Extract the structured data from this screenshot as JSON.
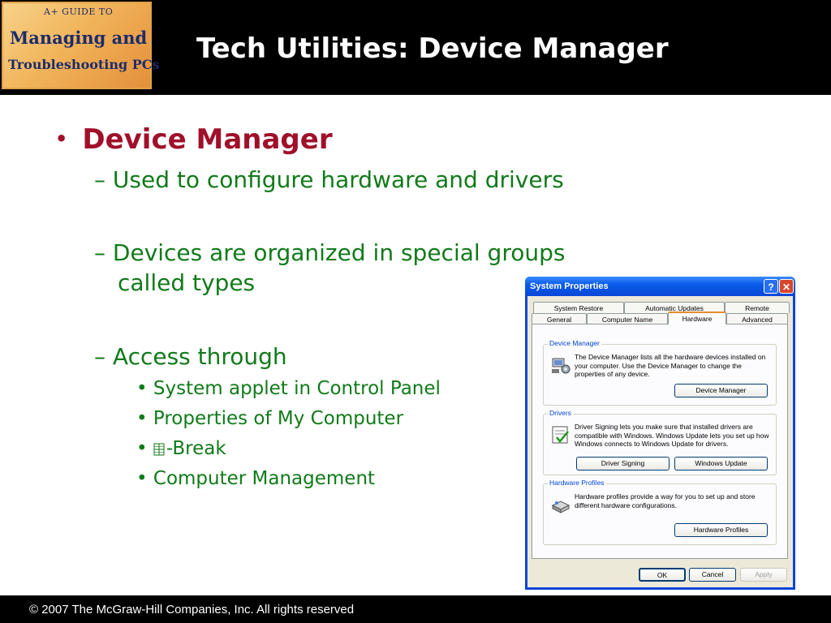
{
  "header": {
    "logo": {
      "line1": "A+ GUIDE TO",
      "line2": "Managing and",
      "line3": "Troubleshooting PCs"
    },
    "title": "Tech Utilities: Device Manager"
  },
  "bullets": {
    "main": "Device Manager",
    "sub1": "– Used to configure hardware and drivers",
    "sub2_line1": "– Devices are organized in special groups",
    "sub2_line2": "called types",
    "sub3": "– Access through",
    "items": [
      "System applet in Control Panel",
      "Properties of My Computer",
      "-Break",
      "Computer Management"
    ]
  },
  "dialog": {
    "title": "System Properties",
    "help": "?",
    "close": "✕",
    "tabs_row1": [
      "System Restore",
      "Automatic Updates",
      "Remote"
    ],
    "tabs_row2": [
      "General",
      "Computer Name",
      "Hardware",
      "Advanced"
    ],
    "selected_tab": "Hardware",
    "device_manager": {
      "label": "Device Manager",
      "text": "The Device Manager lists all the hardware devices installed on your computer. Use the Device Manager to change the properties of any device.",
      "button": "Device Manager"
    },
    "drivers": {
      "label": "Drivers",
      "text": "Driver Signing lets you make sure that installed drivers are compatible with Windows. Windows Update lets you set up how Windows connects to Windows Update for drivers.",
      "button1": "Driver Signing",
      "button2": "Windows Update"
    },
    "hardware_profiles": {
      "label": "Hardware Profiles",
      "text": "Hardware profiles provide a way for you to set up and store different hardware configurations.",
      "button": "Hardware Profiles"
    },
    "ok": "OK",
    "cancel": "Cancel",
    "apply": "Apply"
  },
  "footer": {
    "copyright": "© 2007 The McGraw-Hill Companies, Inc. All rights reserved"
  }
}
